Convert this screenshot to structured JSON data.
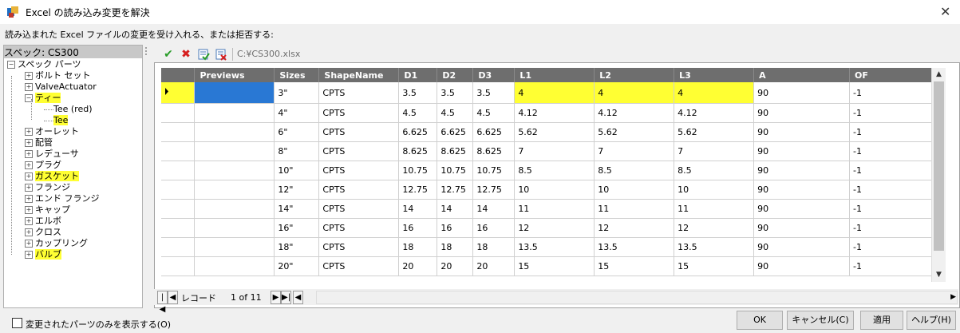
{
  "window": {
    "title": "Excel の読み込み変更を解決",
    "instruction": "読み込まれた Excel ファイルの変更を受け入れる、または拒否する:"
  },
  "tree": {
    "header": "スペック: CS300",
    "root": "スペック パーツ",
    "items": [
      {
        "label": "ボルト セット",
        "highlight": false
      },
      {
        "label": "ValveActuator",
        "highlight": false
      },
      {
        "label": "ティー",
        "highlight": true
      },
      {
        "label": "Tee (red)",
        "highlight": false
      },
      {
        "label": "Tee",
        "highlight": true
      },
      {
        "label": "オーレット",
        "highlight": false
      },
      {
        "label": "配管",
        "highlight": false
      },
      {
        "label": "レデューサ",
        "highlight": false
      },
      {
        "label": "プラグ",
        "highlight": false
      },
      {
        "label": "ガスケット",
        "highlight": true
      },
      {
        "label": "フランジ",
        "highlight": false
      },
      {
        "label": "エンド フランジ",
        "highlight": false
      },
      {
        "label": "キャップ",
        "highlight": false
      },
      {
        "label": "エルボ",
        "highlight": false
      },
      {
        "label": "クロス",
        "highlight": false
      },
      {
        "label": "カップリング",
        "highlight": false
      },
      {
        "label": "バルブ",
        "highlight": true
      }
    ]
  },
  "toolbar": {
    "accept_icon": "checkmark-icon",
    "reject_icon": "x-icon",
    "file_path": "C:¥CS300.xlsx"
  },
  "grid": {
    "columns": [
      "",
      "Previews",
      "Sizes",
      "ShapeName",
      "D1",
      "D2",
      "D3",
      "L1",
      "L2",
      "L3",
      "A",
      "OF"
    ],
    "rows": [
      [
        "3\"",
        "CPTS",
        "3.5",
        "3.5",
        "3.5",
        "4",
        "4",
        "4",
        "90",
        "-1"
      ],
      [
        "4\"",
        "CPTS",
        "4.5",
        "4.5",
        "4.5",
        "4.12",
        "4.12",
        "4.12",
        "90",
        "-1"
      ],
      [
        "6\"",
        "CPTS",
        "6.625",
        "6.625",
        "6.625",
        "5.62",
        "5.62",
        "5.62",
        "90",
        "-1"
      ],
      [
        "8\"",
        "CPTS",
        "8.625",
        "8.625",
        "8.625",
        "7",
        "7",
        "7",
        "90",
        "-1"
      ],
      [
        "10\"",
        "CPTS",
        "10.75",
        "10.75",
        "10.75",
        "8.5",
        "8.5",
        "8.5",
        "90",
        "-1"
      ],
      [
        "12\"",
        "CPTS",
        "12.75",
        "12.75",
        "12.75",
        "10",
        "10",
        "10",
        "90",
        "-1"
      ],
      [
        "14\"",
        "CPTS",
        "14",
        "14",
        "14",
        "11",
        "11",
        "11",
        "90",
        "-1"
      ],
      [
        "16\"",
        "CPTS",
        "16",
        "16",
        "16",
        "12",
        "12",
        "12",
        "90",
        "-1"
      ],
      [
        "18\"",
        "CPTS",
        "18",
        "18",
        "18",
        "13.5",
        "13.5",
        "13.5",
        "90",
        "-1"
      ],
      [
        "20\"",
        "CPTS",
        "20",
        "20",
        "20",
        "15",
        "15",
        "15",
        "90",
        "-1"
      ]
    ],
    "highlight_color": "#ffff33",
    "selection_color": "#2978d4"
  },
  "nav": {
    "record_label": "レコード",
    "position": "1 of 11"
  },
  "footer": {
    "checkbox_label": "変更されたパーツのみを表示する(O)",
    "ok": "OK",
    "cancel": "キャンセル(C)",
    "apply": "適用",
    "help": "ヘルプ(H)"
  }
}
